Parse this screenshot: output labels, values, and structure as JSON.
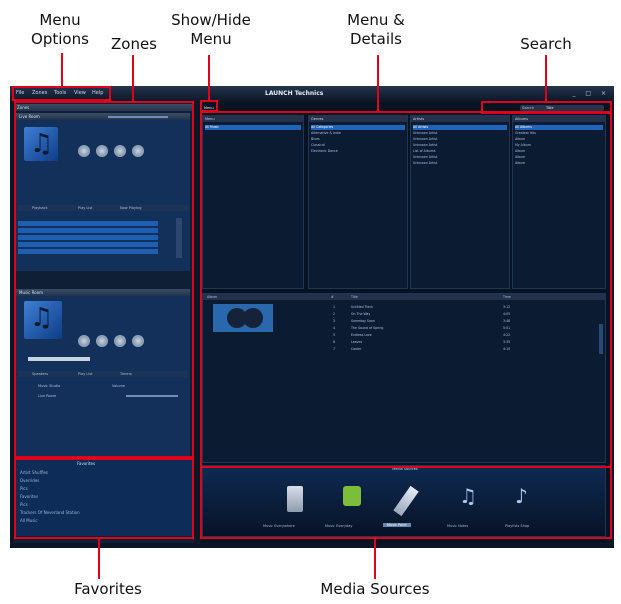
{
  "callouts": {
    "menu_options": "Menu\nOptions",
    "zones": "Zones",
    "show_hide_menu": "Show/Hide\nMenu",
    "menu_details": "Menu &\nDetails",
    "search": "Search",
    "favorites": "Favorites",
    "media_sources": "Media Sources"
  },
  "app": {
    "title": "LAUNCH Technics",
    "menu": [
      "File",
      "Zones",
      "Tools",
      "View",
      "Help"
    ],
    "window_buttons": "_ □ ×"
  },
  "zones": {
    "header": "Zones",
    "zone1": {
      "name": "Live Room",
      "tabs": [
        "Playback",
        "Play List",
        "Now Playing"
      ]
    },
    "zone2": {
      "name": "Music Room",
      "tabs": [
        "Speakers",
        "Play List",
        "Timers"
      ],
      "device": "Music Studio",
      "volume_label": "Volume",
      "secondary": "Live Room"
    }
  },
  "favorites": {
    "header": "Favorites",
    "items": [
      "Artist Shuffles",
      "Overrides",
      "Pics",
      "Favorites",
      "Pics",
      "Trackers Of Neverland Station",
      "All Music"
    ]
  },
  "browser": {
    "menu_label": "Menu",
    "left_list": {
      "header": "Menu",
      "selected": "All Music"
    },
    "genre": {
      "header": "Genres",
      "items": [
        "All Categories",
        "Alternative & Indie",
        "Blues",
        "Classical",
        "Electronic Dance"
      ]
    },
    "artists": {
      "header": "Artists",
      "items": [
        "All Artists",
        "Unknown Artist",
        "Unknown Artist",
        "Unknown Artist",
        "List of Albums",
        "Unknown Artist",
        "Unknown Artist"
      ]
    },
    "albums": {
      "header": "Albums",
      "items": [
        "All Albums",
        "Greatest Hits",
        "Album",
        "My Album",
        "Album",
        "Album",
        "Album"
      ]
    },
    "tracks": {
      "headers": [
        "Album",
        "#",
        "Title",
        "Time"
      ],
      "rows": [
        {
          "num": "1",
          "title": "Untitled Track",
          "time": "3:12"
        },
        {
          "num": "2",
          "title": "On The Way",
          "time": "4:05"
        },
        {
          "num": "3",
          "title": "Someday Soon",
          "time": "3:48"
        },
        {
          "num": "4",
          "title": "The Sound of Spring",
          "time": "5:01"
        },
        {
          "num": "5",
          "title": "Endless Love",
          "time": "4:22"
        },
        {
          "num": "6",
          "title": "Leaves",
          "time": "3:35"
        },
        {
          "num": "7",
          "title": "Cooler",
          "time": "4:10"
        }
      ]
    }
  },
  "search": {
    "label": "Search",
    "value": "Title"
  },
  "sources": {
    "header": "Media Sources",
    "items": [
      {
        "label": "Music Everywhere",
        "icon": "media-player-icon"
      },
      {
        "label": "Music Everyday",
        "icon": "play-icon"
      },
      {
        "label": "Music Point",
        "icon": "usb-icon"
      },
      {
        "label": "Music Notes",
        "icon": "note-icon"
      },
      {
        "label": "Playlists Shop",
        "icon": "network-note-icon"
      }
    ]
  },
  "colors": {
    "accent": "#e0001b",
    "selection": "#1f64b5",
    "background": "#0b1626"
  }
}
